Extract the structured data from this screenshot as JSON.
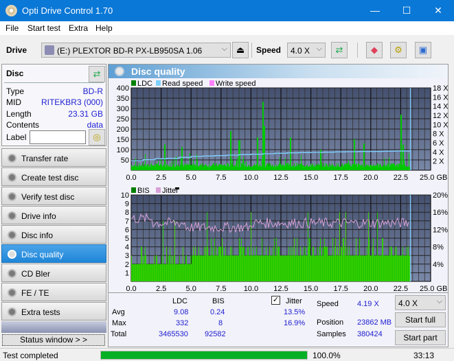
{
  "window": {
    "title": "Opti Drive Control 1.70",
    "minimize": "—",
    "maximize": "☐",
    "close": "✕"
  },
  "menu": [
    "File",
    "Start test",
    "Extra",
    "Help"
  ],
  "toolbar": {
    "drive_label": "Drive",
    "drive_value": "(E:)  PLEXTOR BD-R  PX-LB950SA 1.06",
    "speed_label": "Speed",
    "speed_value": "4.0 X"
  },
  "disc": {
    "header": "Disc",
    "props": [
      {
        "label": "Type",
        "value": "BD-R"
      },
      {
        "label": "MID",
        "value": "RITEKBR3 (000)"
      },
      {
        "label": "Length",
        "value": "23.31 GB"
      },
      {
        "label": "Contents",
        "value": "data"
      }
    ],
    "label_field": "Label",
    "label_value": ""
  },
  "nav": [
    {
      "label": "Transfer rate",
      "active": false
    },
    {
      "label": "Create test disc",
      "active": false
    },
    {
      "label": "Verify test disc",
      "active": false
    },
    {
      "label": "Drive info",
      "active": false
    },
    {
      "label": "Disc info",
      "active": false
    },
    {
      "label": "Disc quality",
      "active": true
    },
    {
      "label": "CD Bler",
      "active": false
    },
    {
      "label": "FE / TE",
      "active": false
    },
    {
      "label": "Extra tests",
      "active": false
    }
  ],
  "status_window_btn": "Status window > >",
  "panel_title": "Disc quality",
  "chart_data": [
    {
      "type": "bar",
      "title": "LDC / Read speed",
      "legend": [
        "LDC",
        "Read speed",
        "Write speed"
      ],
      "x_ticks": [
        "0.0",
        "2.5",
        "5.0",
        "7.5",
        "10.0",
        "12.5",
        "15.0",
        "17.5",
        "20.0",
        "22.5",
        "25.0 GB"
      ],
      "y_ticks": [
        "400",
        "350",
        "300",
        "250",
        "200",
        "150",
        "100",
        "50"
      ],
      "y2_ticks": [
        "18 X",
        "16 X",
        "14 X",
        "12 X",
        "10 X",
        "8 X",
        "6 X",
        "4 X",
        "2 X"
      ],
      "xlim": [
        0,
        25
      ],
      "ylim": [
        0,
        400
      ],
      "y2lim": [
        0,
        18
      ],
      "ldc_peaks": [
        [
          2.8,
          125
        ],
        [
          4.2,
          112
        ],
        [
          8.3,
          190
        ],
        [
          9.0,
          145
        ],
        [
          10.5,
          160
        ],
        [
          11.0,
          332
        ],
        [
          11.1,
          215
        ],
        [
          13.3,
          160
        ],
        [
          15.8,
          100
        ],
        [
          18.6,
          150
        ],
        [
          19.4,
          130
        ],
        [
          22.5,
          270
        ],
        [
          22.7,
          125
        ]
      ],
      "read_speed": [
        [
          0,
          2.1
        ],
        [
          1,
          2.3
        ],
        [
          2,
          2.5
        ],
        [
          3,
          2.6
        ],
        [
          4,
          2.8
        ],
        [
          5,
          3.0
        ],
        [
          6,
          3.1
        ],
        [
          7,
          3.2
        ],
        [
          8,
          3.3
        ],
        [
          9,
          3.4
        ],
        [
          10,
          3.5
        ],
        [
          11,
          3.6
        ],
        [
          12,
          3.7
        ],
        [
          13,
          3.8
        ],
        [
          14,
          3.85
        ],
        [
          15,
          3.9
        ],
        [
          16,
          3.95
        ],
        [
          17,
          4.0
        ],
        [
          18,
          4.05
        ],
        [
          19,
          4.1
        ],
        [
          20,
          4.1
        ],
        [
          21,
          4.15
        ],
        [
          22,
          4.19
        ],
        [
          23.31,
          4.19
        ]
      ],
      "end_gb": 23.31,
      "ldc_baseline": 25
    },
    {
      "type": "bar",
      "title": "BIS / Jitter",
      "legend": [
        "BIS",
        "Jitter"
      ],
      "x_ticks": [
        "0.0",
        "2.5",
        "5.0",
        "7.5",
        "10.0",
        "12.5",
        "15.0",
        "17.5",
        "20.0",
        "22.5",
        "25.0 GB"
      ],
      "y_ticks": [
        "10",
        "9",
        "8",
        "7",
        "6",
        "5",
        "4",
        "3",
        "2",
        "1"
      ],
      "y2_ticks": [
        "20%",
        "16%",
        "12%",
        "8%",
        "4%"
      ],
      "xlim": [
        0,
        25
      ],
      "ylim": [
        0,
        10
      ],
      "y2lim": [
        0,
        20
      ],
      "bis_max": 8,
      "jitter_avg": 13.5,
      "jitter_max": 16.9,
      "end_gb": 23.31
    }
  ],
  "stats": {
    "cols": [
      "LDC",
      "BIS"
    ],
    "jitter_label": "Jitter",
    "jitter_checked": true,
    "rows": [
      {
        "label": "Avg",
        "ldc": "9.08",
        "bis": "0.24",
        "jitter": "13.5%"
      },
      {
        "label": "Max",
        "ldc": "332",
        "bis": "8",
        "jitter": "16.9%"
      },
      {
        "label": "Total",
        "ldc": "3465530",
        "bis": "92582",
        "jitter": ""
      }
    ],
    "speed_label": "Speed",
    "speed_value": "4.19 X",
    "position_label": "Position",
    "position_value": "23862 MB",
    "samples_label": "Samples",
    "samples_value": "380424",
    "speed_select": "4.0 X",
    "start_full": "Start full",
    "start_part": "Start part"
  },
  "statusbar": {
    "text": "Test completed",
    "progress": 100,
    "progress_text": "100.0%",
    "time": "33:13"
  },
  "colors": {
    "ldc": "#00c800",
    "read_speed": "#7fd0ff",
    "write_speed": "#ff80ff",
    "jitter": "#d7a0d7",
    "plot_bg_top": "#44506e",
    "plot_bg_bottom": "#7a88a8",
    "accent": "#0a78d7"
  }
}
